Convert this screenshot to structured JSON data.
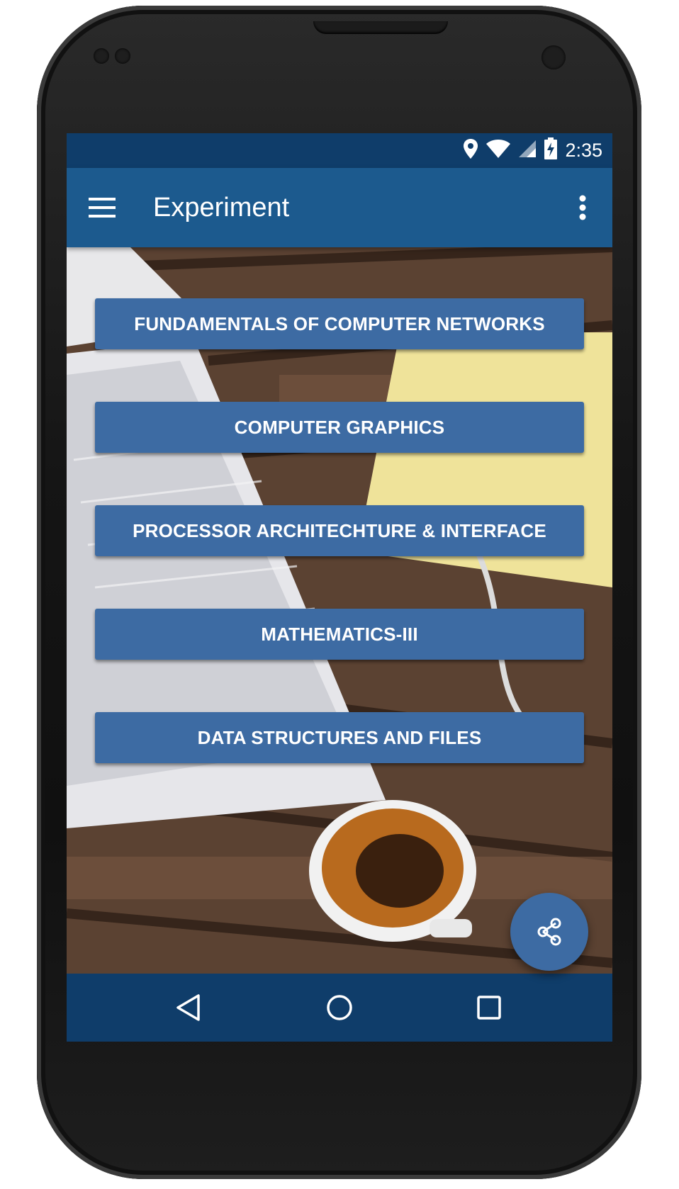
{
  "status_bar": {
    "time": "2:35",
    "icons": [
      "location-icon",
      "wifi-icon",
      "cell-signal-icon",
      "battery-charging-icon"
    ]
  },
  "app_bar": {
    "title": "Experiment",
    "nav_icon": "menu-icon",
    "overflow_icon": "more-vert-icon"
  },
  "subjects": [
    {
      "label": "FUNDAMENTALS OF COMPUTER NETWORKS"
    },
    {
      "label": "COMPUTER GRAPHICS"
    },
    {
      "label": "PROCESSOR ARCHITECHTURE & INTERFACE"
    },
    {
      "label": "MATHEMATICS-III"
    },
    {
      "label": "DATA STRUCTURES AND FILES"
    }
  ],
  "fab": {
    "icon": "share-icon"
  },
  "nav_bar": {
    "icons": [
      "back-icon",
      "home-icon",
      "recents-icon"
    ]
  },
  "colors": {
    "status_bar": "#0f3d6a",
    "app_bar": "#1c5a8e",
    "button": "#3d6ba3",
    "nav_bar": "#0f3d6a"
  }
}
